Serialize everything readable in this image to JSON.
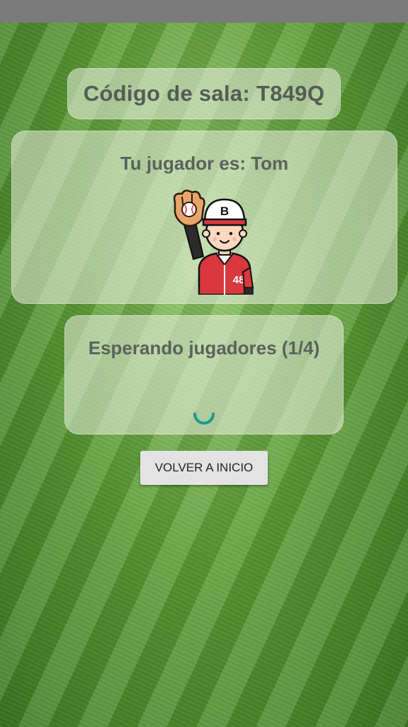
{
  "room": {
    "code_text": "Código de sala: T849Q"
  },
  "player": {
    "label": "Tu jugador es: Tom",
    "avatar_icon": "baseball-player-icon",
    "jersey_number": "48",
    "cap_letter": "B"
  },
  "waiting": {
    "text": "Esperando jugadores (1/4)",
    "spinner_icon": "loading-spinner-icon"
  },
  "actions": {
    "back_label": "VOLVER A INICIO"
  },
  "colors": {
    "spinner": "#1a9a8a",
    "panel_text": "#5b615b",
    "status_bar": "#7a7a7a"
  }
}
